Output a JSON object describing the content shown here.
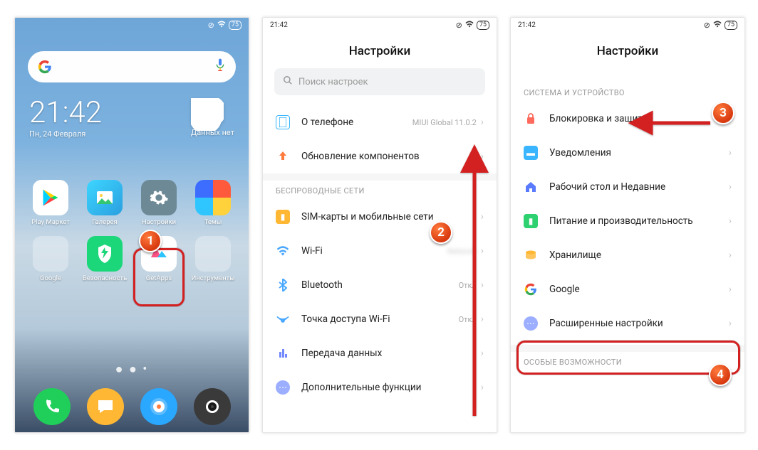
{
  "status": {
    "time": "21:42",
    "battery": "75"
  },
  "home": {
    "clock": "21:42",
    "date": "Пн, 24 Февраля",
    "weather": "Данных нет",
    "apps_row1": [
      {
        "label": "Play Маркет"
      },
      {
        "label": "Галерея"
      },
      {
        "label": "Настройки"
      },
      {
        "label": "Темы"
      }
    ],
    "apps_row2": [
      {
        "label": "Google"
      },
      {
        "label": "Безопасность"
      },
      {
        "label": "GetApps"
      },
      {
        "label": "Инструменты"
      }
    ]
  },
  "settings": {
    "title": "Настройки",
    "search_placeholder": "Поиск настроек",
    "about": {
      "label": "О телефоне",
      "value": "MIUI Global 11.0.2"
    },
    "update": {
      "label": "Обновление компонентов"
    },
    "wireless_header": "БЕСПРОВОДНЫЕ СЕТИ",
    "sim": {
      "label": "SIM-карты и мобильные сети"
    },
    "wifi": {
      "label": "Wi-Fi",
      "value": ""
    },
    "bt": {
      "label": "Bluetooth",
      "value": "Откл"
    },
    "hotspot": {
      "label": "Точка доступа Wi-Fi",
      "value": "Откл"
    },
    "data": {
      "label": "Передача данных"
    },
    "more": {
      "label": "Дополнительные функции"
    }
  },
  "settings2": {
    "title": "Настройки",
    "system_header": "СИСТЕМА И УСТРОЙСТВО",
    "lock": {
      "label": "Блокировка и защита"
    },
    "notif": {
      "label": "Уведомления"
    },
    "home": {
      "label": "Рабочий стол и Недавние"
    },
    "perf": {
      "label": "Питание и производительность"
    },
    "storage": {
      "label": "Хранилище"
    },
    "google": {
      "label": "Google"
    },
    "advanced": {
      "label": "Расширенные настройки"
    },
    "special_header": "ОСОБЫЕ ВОЗМОЖНОСТИ"
  },
  "badges": {
    "b1": "1",
    "b2": "2",
    "b3": "3",
    "b4": "4"
  }
}
